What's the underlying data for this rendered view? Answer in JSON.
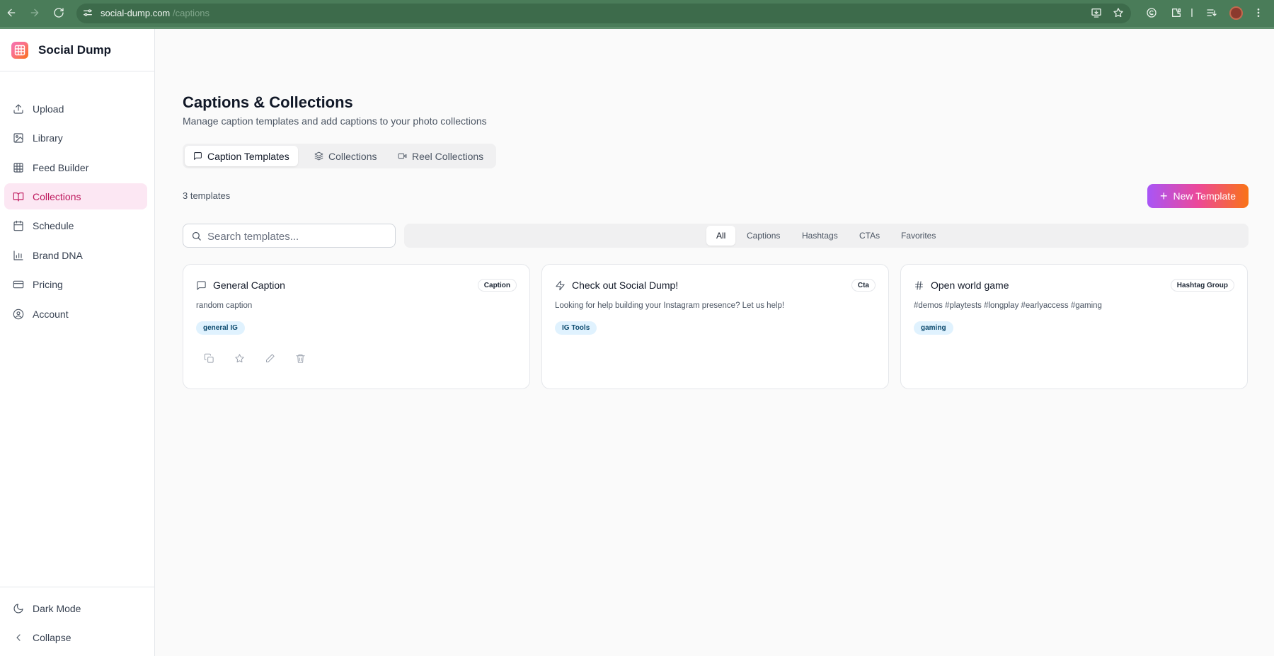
{
  "browser": {
    "url_domain": "social-dump.com",
    "url_path": "/captions"
  },
  "sidebar": {
    "brand": "Social Dump",
    "items": [
      {
        "label": "Upload",
        "icon": "upload-icon"
      },
      {
        "label": "Library",
        "icon": "image-icon"
      },
      {
        "label": "Feed Builder",
        "icon": "grid-icon"
      },
      {
        "label": "Collections",
        "icon": "book-open-icon",
        "active": true
      },
      {
        "label": "Schedule",
        "icon": "calendar-icon"
      },
      {
        "label": "Brand DNA",
        "icon": "bar-chart-icon"
      },
      {
        "label": "Pricing",
        "icon": "credit-card-icon"
      },
      {
        "label": "Account",
        "icon": "user-circle-icon"
      }
    ],
    "dark_mode": "Dark Mode",
    "collapse": "Collapse"
  },
  "main": {
    "title": "Captions & Collections",
    "subtitle": "Manage caption templates and add captions to your photo collections",
    "tabs": [
      {
        "label": "Caption Templates",
        "icon": "message-square-icon",
        "active": true
      },
      {
        "label": "Collections",
        "icon": "layers-icon"
      },
      {
        "label": "Reel Collections",
        "icon": "video-icon"
      }
    ],
    "count": "3 templates",
    "new_button": "New Template",
    "search_placeholder": "Search templates...",
    "filters": [
      {
        "label": "All",
        "active": true
      },
      {
        "label": "Captions"
      },
      {
        "label": "Hashtags"
      },
      {
        "label": "CTAs"
      },
      {
        "label": "Favorites"
      }
    ],
    "cards": [
      {
        "title": "General Caption",
        "icon": "message-square-icon",
        "type": "Caption",
        "text": "random caption",
        "tag": "general IG"
      },
      {
        "title": "Check out Social Dump!",
        "icon": "zap-icon",
        "type": "Cta",
        "text": "Looking for help building your Instagram presence? Let us help!",
        "tag": "IG Tools"
      },
      {
        "title": "Open world game",
        "icon": "hash-icon",
        "type": "Hashtag Group",
        "text": "#demos #playtests #longplay #earlyaccess #gaming",
        "tag": "gaming"
      }
    ]
  },
  "colors": {
    "browser_bar": "#4a7c59",
    "accent": "#be185d",
    "active_nav_bg": "#fce7f3",
    "button_gradient": [
      "#a855f7",
      "#ec4899",
      "#f97316"
    ]
  }
}
